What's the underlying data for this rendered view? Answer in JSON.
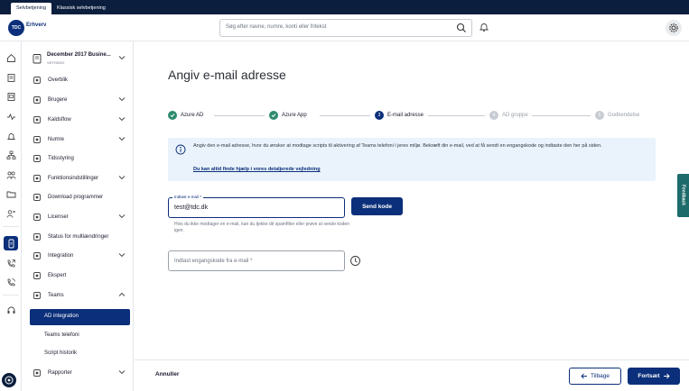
{
  "topbar": {
    "tab_active": "Selvbetjening",
    "tab_classic": "Klassisk selvbetjening"
  },
  "header": {
    "logo": "TDC",
    "brand": "Erhverv",
    "search_placeholder": "Søg efter navne, numre, konti eller fritekst"
  },
  "org": {
    "name": "December 2017 Busine...",
    "sub": "VKTHXDO"
  },
  "nav": [
    {
      "label": "Overblik",
      "icon": "dashboard-icon"
    },
    {
      "label": "Brugere",
      "icon": "users-icon",
      "chevron": true
    },
    {
      "label": "Kaldsflow",
      "icon": "flow-icon",
      "chevron": true
    },
    {
      "label": "Numre",
      "icon": "numbers-icon",
      "chevron": true
    },
    {
      "label": "Tidsstyring",
      "icon": "clock-icon"
    },
    {
      "label": "Funktionsindstillinger",
      "icon": "settings-icon",
      "chevron": true
    },
    {
      "label": "Download programmer",
      "icon": "download-icon"
    },
    {
      "label": "Licenser",
      "icon": "license-icon",
      "chevron": true
    },
    {
      "label": "Status for multiændringer",
      "icon": "status-icon"
    },
    {
      "label": "Integration",
      "icon": "integration-icon",
      "chevron": true
    },
    {
      "label": "Ekspert",
      "icon": "expert-icon"
    },
    {
      "label": "Teams",
      "icon": "teams-icon",
      "chevron_up": true
    }
  ],
  "subnav": [
    "AD integration",
    "Teams telefoni",
    "Script historik"
  ],
  "nav_bottom": {
    "label": "Rapporter"
  },
  "page": {
    "title": "Angiv e-mail adresse"
  },
  "steps": [
    {
      "label": "Azure AD",
      "state": "done"
    },
    {
      "label": "Azure App",
      "state": "done"
    },
    {
      "label": "E-mail adresse",
      "num": "3",
      "state": "current"
    },
    {
      "label": "AD gruppe",
      "num": "4",
      "state": "todo"
    },
    {
      "label": "Godkendelse",
      "num": "5",
      "state": "todo"
    }
  ],
  "info": {
    "text": "Angiv den e-mail adresse, hvor du ønsker at modtage scripts til aktivering af Teams telefoni i jeres miljø. Bekræft din e-mail, ved at få sendt en engangskode og indtaste den her på siden.",
    "link": "Du kan altid finde hjælp i vores detaljerede vejledning"
  },
  "email": {
    "label": "Indtast e-mail *",
    "value": "test@tdc.dk",
    "send": "Send kode",
    "hint": "Hvis du ikke modtager en e-mail, kan du tjekke dit spamfilter eller prøve at sende koden igen."
  },
  "code": {
    "placeholder": "Indtast engangskode fra e-mail *"
  },
  "footer": {
    "cancel": "Annuller",
    "back": "Tilbage",
    "next": "Fortsæt"
  },
  "feedback": "Feedback",
  "colors": {
    "primary": "#0b2f7a",
    "done": "#2e8b6e",
    "dark": "#0b1e3d"
  }
}
